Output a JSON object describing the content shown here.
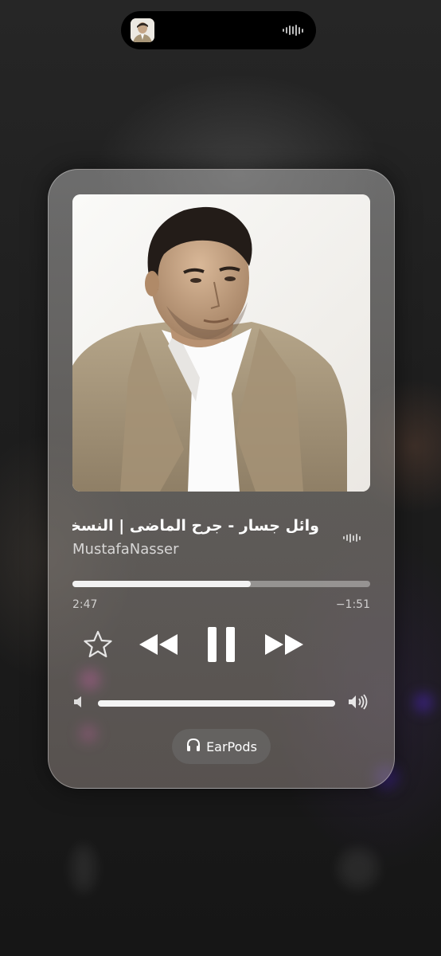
{
  "dynamic_island": {
    "artwork_icon": "album-thumbnail",
    "activity_icon": "waveform-icon"
  },
  "now_playing": {
    "artwork_icon": "album-artwork-portrait",
    "title": "وائل جسار - جرح الماضى | النسخة الاصلية",
    "artist": "MustafaNasser",
    "progress": 0.6,
    "elapsed": "2:47",
    "remaining": "−1:51",
    "volume": 1.0
  },
  "controls": {
    "favorite_icon": "star-icon",
    "rewind_icon": "rewind-icon",
    "pause_icon": "pause-icon",
    "forward_icon": "fast-forward-icon",
    "volume_low_icon": "speaker-low-icon",
    "volume_high_icon": "speaker-high-icon"
  },
  "route": {
    "icon": "headphones-icon",
    "label": "EarPods"
  },
  "colors": {
    "card_bg": "#9a9691",
    "text": "#ffffff",
    "island": "#000000"
  }
}
